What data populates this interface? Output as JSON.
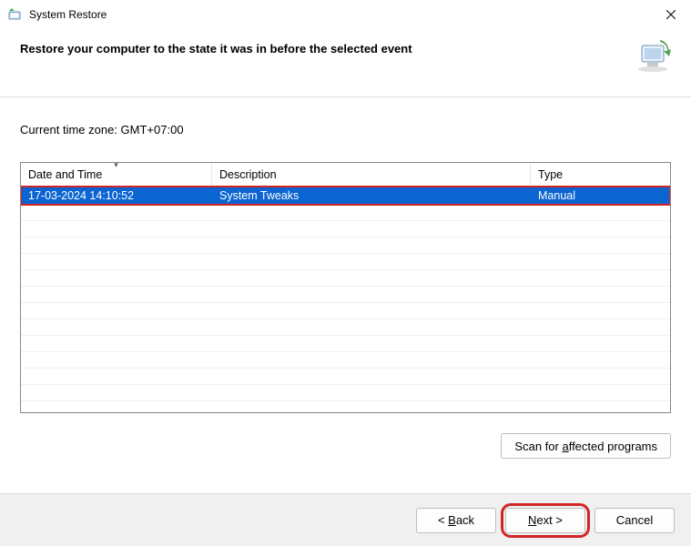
{
  "window": {
    "title": "System Restore"
  },
  "header": {
    "heading": "Restore your computer to the state it was in before the selected event"
  },
  "content": {
    "timezone_label": "Current time zone: GMT+07:00",
    "columns": {
      "datetime": "Date and Time",
      "description": "Description",
      "type": "Type"
    },
    "rows": [
      {
        "datetime": "17-03-2024 14:10:52",
        "description": "System Tweaks",
        "type": "Manual"
      }
    ]
  },
  "buttons": {
    "scan_pre": "Scan for ",
    "scan_ul": "a",
    "scan_post": "ffected programs",
    "back_pre": "< ",
    "back_ul": "B",
    "back_post": "ack",
    "next_ul": "N",
    "next_post": "ext >",
    "cancel": "Cancel"
  }
}
